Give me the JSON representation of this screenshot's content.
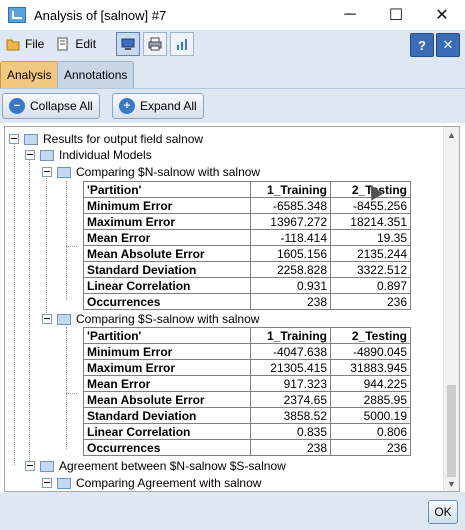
{
  "window": {
    "title": "Analysis of [salnow] #7",
    "minimize": "─",
    "maximize": "☐",
    "close": "✕"
  },
  "toolbar": {
    "file_label": "File",
    "edit_label": "Edit",
    "help_label": "?",
    "close_label": "✕"
  },
  "tabs": [
    {
      "label": "Analysis",
      "active": true
    },
    {
      "label": "Annotations",
      "active": false
    }
  ],
  "actions": {
    "collapse_all": "Collapse All",
    "expand_all": "Expand All"
  },
  "tree": {
    "root": "Results for output field salnow",
    "individual_models": "Individual Models",
    "agreement": "Agreement between  $N-salnow $S-salnow",
    "comparing_agreement": "Comparing Agreement with salnow"
  },
  "comparisons": [
    {
      "title": "Comparing $N-salnow with salnow",
      "header": [
        "'Partition'",
        "1_Training",
        "2_Testing"
      ],
      "rows": [
        {
          "label": "Minimum Error",
          "train": "-6585.348",
          "test": "-8455.256"
        },
        {
          "label": "Maximum Error",
          "train": "13967.272",
          "test": "18214.351"
        },
        {
          "label": "Mean Error",
          "train": "-118.414",
          "test": "19.35"
        },
        {
          "label": "Mean Absolute Error",
          "train": "1605.156",
          "test": "2135.244"
        },
        {
          "label": "Standard Deviation",
          "train": "2258.828",
          "test": "3322.512"
        },
        {
          "label": "Linear Correlation",
          "train": "0.931",
          "test": "0.897"
        },
        {
          "label": "Occurrences",
          "train": "238",
          "test": "236"
        }
      ]
    },
    {
      "title": "Comparing $S-salnow with salnow",
      "header": [
        "'Partition'",
        "1_Training",
        "2_Testing"
      ],
      "rows": [
        {
          "label": "Minimum Error",
          "train": "-4047.638",
          "test": "-4890.045"
        },
        {
          "label": "Maximum Error",
          "train": "21305.415",
          "test": "31883.945"
        },
        {
          "label": "Mean Error",
          "train": "917.323",
          "test": "944.225"
        },
        {
          "label": "Mean Absolute Error",
          "train": "2374.65",
          "test": "2885.95"
        },
        {
          "label": "Standard Deviation",
          "train": "3858.52",
          "test": "5000.19"
        },
        {
          "label": "Linear Correlation",
          "train": "0.835",
          "test": "0.806"
        },
        {
          "label": "Occurrences",
          "train": "238",
          "test": "236"
        }
      ]
    }
  ],
  "footer": {
    "ok_label": "OK"
  }
}
